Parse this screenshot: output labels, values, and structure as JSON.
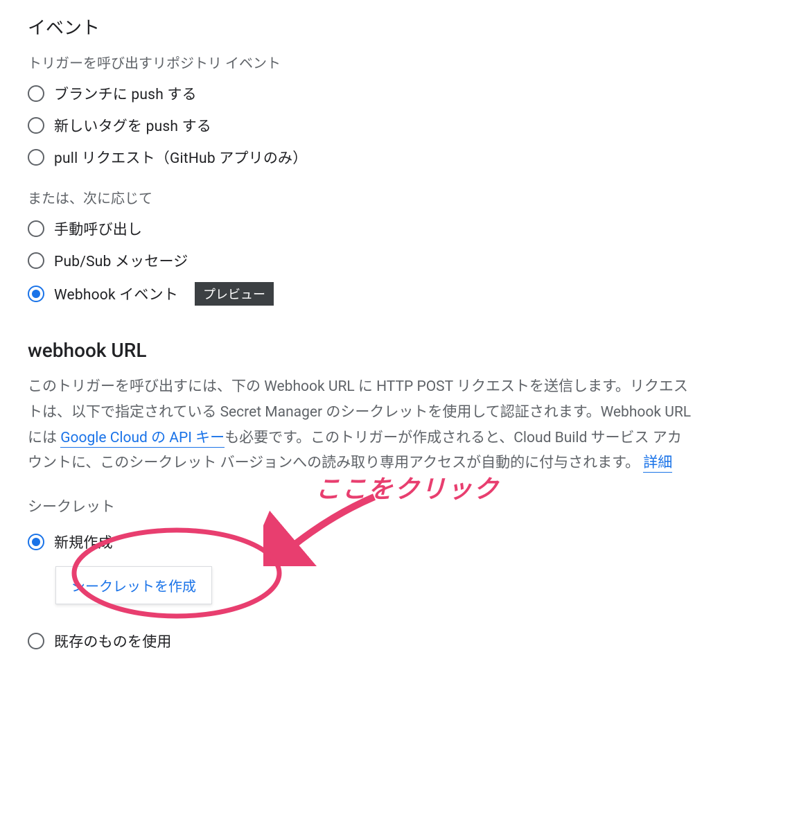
{
  "event": {
    "title": "イベント",
    "subtitle1": "トリガーを呼び出すリポジトリ イベント",
    "options1": [
      {
        "label": "ブランチに push する",
        "selected": false
      },
      {
        "label": "新しいタグを push する",
        "selected": false
      },
      {
        "label": "pull リクエスト（GitHub アプリのみ）",
        "selected": false
      }
    ],
    "subtitle2": "または、次に応じて",
    "options2": [
      {
        "label": "手動呼び出し",
        "selected": false,
        "badge": null
      },
      {
        "label": "Pub/Sub メッセージ",
        "selected": false,
        "badge": null
      },
      {
        "label": "Webhook イベント",
        "selected": true,
        "badge": "プレビュー"
      }
    ]
  },
  "webhook": {
    "title": "webhook URL",
    "desc_part1": "このトリガーを呼び出すには、下の Webhook URL に HTTP POST リクエストを送信します。リクエストは、以下で指定されている Secret Manager のシークレットを使用して認証されます。Webhook URL には ",
    "desc_link1": "Google Cloud の API キー",
    "desc_part2": "も必要です。このトリガーが作成されると、Cloud Build サービス アカウントに、このシークレット バージョンへの読み取り専用アクセスが自動的に付与されます。 ",
    "desc_link2": "詳細"
  },
  "secret": {
    "label": "シークレット",
    "option_new": "新規作成",
    "create_button": "シークレットを作成",
    "option_existing": "既存のものを使用"
  },
  "annotation": {
    "text": "ここをクリック"
  }
}
